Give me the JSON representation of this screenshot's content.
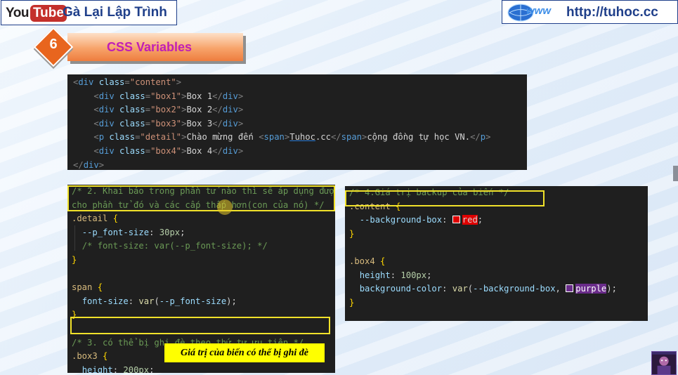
{
  "header": {
    "youtube_you": "You",
    "youtube_tube": "Tube",
    "channel_name": "Gà Lại Lập Trình",
    "www_text": "www",
    "site_url": "http://tuhoc.cc"
  },
  "section": {
    "number": "6",
    "title": "CSS Variables"
  },
  "html_code": [
    [
      [
        "t",
        "<"
      ],
      [
        "tn",
        "div"
      ],
      [
        "an",
        " class"
      ],
      [
        "t",
        "="
      ],
      [
        "av",
        "\"content\""
      ],
      [
        "t",
        ">"
      ]
    ],
    [
      [
        "tx",
        "    "
      ],
      [
        "t",
        "<"
      ],
      [
        "tn",
        "div"
      ],
      [
        "an",
        " class"
      ],
      [
        "t",
        "="
      ],
      [
        "av",
        "\"box1\""
      ],
      [
        "t",
        ">"
      ],
      [
        "tx",
        "Box 1"
      ],
      [
        "t",
        "</"
      ],
      [
        "tn",
        "div"
      ],
      [
        "t",
        ">"
      ]
    ],
    [
      [
        "tx",
        "    "
      ],
      [
        "t",
        "<"
      ],
      [
        "tn",
        "div"
      ],
      [
        "an",
        " class"
      ],
      [
        "t",
        "="
      ],
      [
        "av",
        "\"box2\""
      ],
      [
        "t",
        ">"
      ],
      [
        "tx",
        "Box 2"
      ],
      [
        "t",
        "</"
      ],
      [
        "tn",
        "div"
      ],
      [
        "t",
        ">"
      ]
    ],
    [
      [
        "tx",
        "    "
      ],
      [
        "t",
        "<"
      ],
      [
        "tn",
        "div"
      ],
      [
        "an",
        " class"
      ],
      [
        "t",
        "="
      ],
      [
        "av",
        "\"box3\""
      ],
      [
        "t",
        ">"
      ],
      [
        "tx",
        "Box 3"
      ],
      [
        "t",
        "</"
      ],
      [
        "tn",
        "div"
      ],
      [
        "t",
        ">"
      ]
    ],
    [
      [
        "tx",
        "    "
      ],
      [
        "t",
        "<"
      ],
      [
        "tn",
        "p"
      ],
      [
        "an",
        " class"
      ],
      [
        "t",
        "="
      ],
      [
        "av",
        "\"detail\""
      ],
      [
        "t",
        ">"
      ],
      [
        "tx",
        "Chào mừng đến "
      ],
      [
        "t",
        "<"
      ],
      [
        "tn",
        "span"
      ],
      [
        "t",
        ">"
      ],
      [
        "tx ul",
        "Tuhoc"
      ],
      [
        "tx",
        ".cc"
      ],
      [
        "t",
        "</"
      ],
      [
        "tn",
        "span"
      ],
      [
        "t",
        ">"
      ],
      [
        "tx",
        "cộng đồng tự học VN."
      ],
      [
        "t",
        "</"
      ],
      [
        "tn",
        "p"
      ],
      [
        "t",
        ">"
      ]
    ],
    [
      [
        "tx",
        "    "
      ],
      [
        "t",
        "<"
      ],
      [
        "tn",
        "div"
      ],
      [
        "an",
        " class"
      ],
      [
        "t",
        "="
      ],
      [
        "av",
        "\"box4\""
      ],
      [
        "t",
        ">"
      ],
      [
        "tx",
        "Box 4"
      ],
      [
        "t",
        "</"
      ],
      [
        "tn",
        "div"
      ],
      [
        "t",
        ">"
      ]
    ],
    [
      [
        "t",
        "</"
      ],
      [
        "tn",
        "div"
      ],
      [
        "t",
        ">"
      ]
    ]
  ],
  "css_left": [
    [
      [
        "cm",
        "/* 2. Khai báo trong phần tử nào thì sẽ áp dụng được"
      ]
    ],
    [
      [
        "cm",
        "cho phần tử đó và các cấp thấp hơn(con của nó) */"
      ]
    ],
    [
      [
        "sel",
        ".detail"
      ],
      [
        "kw",
        " "
      ],
      [
        "br",
        "{"
      ]
    ],
    [
      [
        "kw",
        "  "
      ],
      [
        "pr",
        "--p_font-size"
      ],
      [
        "kw",
        ": "
      ],
      [
        "nm",
        "30px"
      ],
      [
        "kw",
        ";"
      ]
    ],
    [
      [
        "kw",
        "  "
      ],
      [
        "cm",
        "/* font-size: var(--p_font-size); */"
      ]
    ],
    [
      [
        "br",
        "}"
      ]
    ],
    [
      [
        "kw",
        " "
      ]
    ],
    [
      [
        "sel",
        "span"
      ],
      [
        "kw",
        " "
      ],
      [
        "br",
        "{"
      ]
    ],
    [
      [
        "kw",
        "  "
      ],
      [
        "pr",
        "font-size"
      ],
      [
        "kw",
        ": "
      ],
      [
        "fn",
        "var"
      ],
      [
        "kw",
        "("
      ],
      [
        "pr",
        "--p_font-size"
      ],
      [
        "kw",
        ");"
      ]
    ],
    [
      [
        "br",
        "}"
      ]
    ],
    [
      [
        "kw",
        " "
      ]
    ],
    [
      [
        "cm",
        "/* 3. có thể bị ghi đè theo thứ tự ưu tiên */"
      ]
    ],
    [
      [
        "sel",
        ".box3"
      ],
      [
        "kw",
        " "
      ],
      [
        "br",
        "{"
      ]
    ],
    [
      [
        "kw",
        "  "
      ],
      [
        "pr",
        "height"
      ],
      [
        "kw",
        ": "
      ],
      [
        "nm",
        "200px"
      ],
      [
        "kw",
        ";"
      ]
    ],
    [
      [
        "br",
        "}"
      ]
    ]
  ],
  "css_right": [
    [
      [
        "cm",
        "/* 4.Giá trị backup của biến */"
      ]
    ],
    [
      [
        "sel",
        ".content"
      ],
      [
        "kw",
        " "
      ],
      [
        "br",
        "{"
      ]
    ],
    [
      [
        "kw",
        "  "
      ],
      [
        "pr",
        "--background-box"
      ],
      [
        "kw",
        ": "
      ],
      [
        "swatch-red",
        "red"
      ],
      [
        "kw",
        ";"
      ]
    ],
    [
      [
        "br",
        "}"
      ]
    ],
    [
      [
        "kw",
        " "
      ]
    ],
    [
      [
        "sel",
        ".box4"
      ],
      [
        "kw",
        " "
      ],
      [
        "br",
        "{"
      ]
    ],
    [
      [
        "kw",
        "  "
      ],
      [
        "pr",
        "height"
      ],
      [
        "kw",
        ": "
      ],
      [
        "nm",
        "100px"
      ],
      [
        "kw",
        ";"
      ]
    ],
    [
      [
        "kw",
        "  "
      ],
      [
        "pr",
        "background-color"
      ],
      [
        "kw",
        ": "
      ],
      [
        "fn",
        "var"
      ],
      [
        "kw",
        "("
      ],
      [
        "pr",
        "--background-box"
      ],
      [
        "kw",
        ", "
      ],
      [
        "swatch-purple",
        "purple"
      ],
      [
        "kw",
        ");"
      ]
    ],
    [
      [
        "br",
        "}"
      ]
    ]
  ],
  "note": "Giá trị của biến có thể bị ghi đè",
  "colors": {
    "accent_orange": "#ee7d3e",
    "title_magenta": "#c01fb6",
    "highlight_yellow": "#f0e12a",
    "note_bg": "#ffff00"
  },
  "icons": [
    "youtube-logo-icon",
    "www-globe-icon",
    "presenter-avatar-icon"
  ]
}
